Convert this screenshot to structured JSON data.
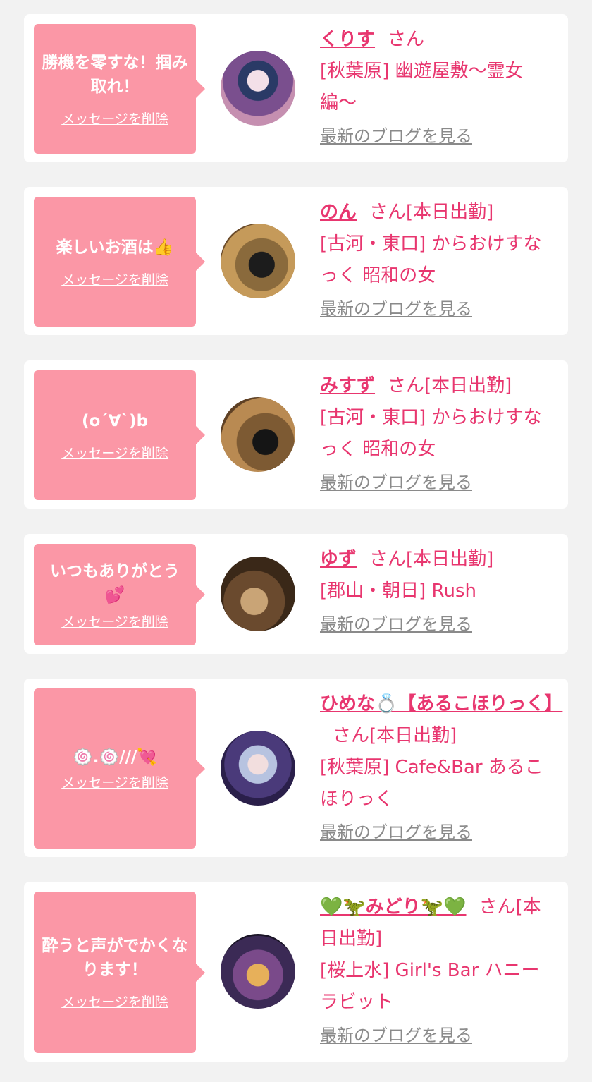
{
  "delete_label": "メッセージを削除",
  "blog_label": "最新のブログを見る",
  "colors": {
    "background": "#f2f2f2",
    "bubble": "#fb97a6",
    "accent": "#e8366f",
    "blog_link": "#8a8a8a"
  },
  "cards": [
    {
      "message": "勝機を零すな！掴み取れ！",
      "name": "くりす",
      "suffix": "さん",
      "shop": "[秋葉原] 幽遊屋敷〜霊女編〜"
    },
    {
      "message": "楽しいお酒は👍",
      "name": "のん",
      "suffix": "さん[本日出勤]",
      "shop": "[古河・東口] からおけすなっく 昭和の女"
    },
    {
      "message": "(o´∀`)b",
      "name": "みすず",
      "suffix": "さん[本日出勤]",
      "shop": "[古河・東口] からおけすなっく 昭和の女"
    },
    {
      "message": "いつもありがとう💕",
      "name": "ゆず",
      "suffix": "さん[本日出勤]",
      "shop": "[郡山・朝日] Rush"
    },
    {
      "message": "🍥.🍥///💘",
      "name": "ひめな💍【あるこほりっく】",
      "suffix": "さん[本日出勤]",
      "shop": "[秋葉原] Cafe&Bar あるこほりっく"
    },
    {
      "message": "酔うと声がでかくなります！",
      "name": "💚🦖みどり🦖💚",
      "suffix": "さん[本日出勤]",
      "shop": "[桜上水] Girl's Bar ハニーラビット"
    }
  ]
}
